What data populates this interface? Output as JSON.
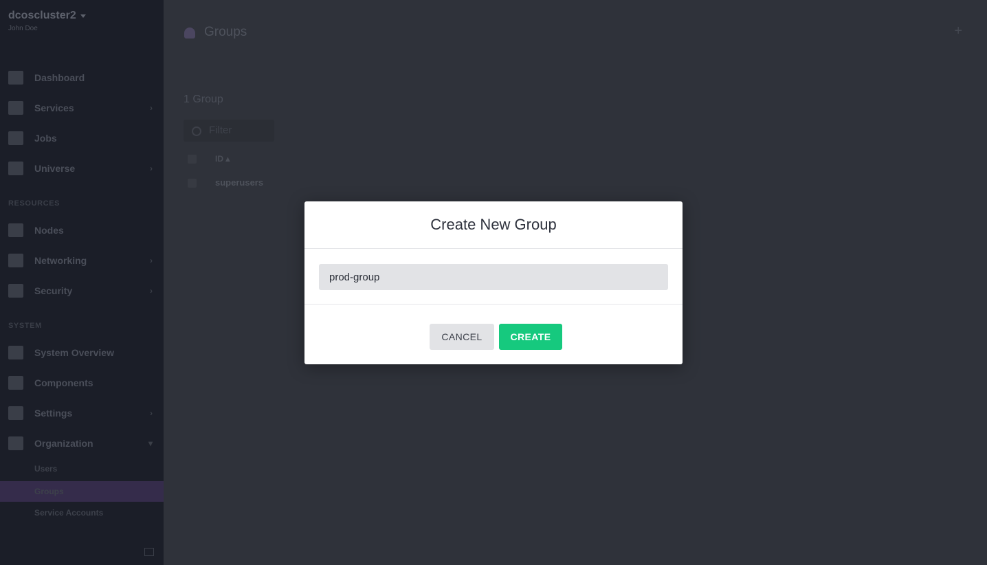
{
  "sidebar": {
    "cluster_name": "dcoscluster2",
    "user_name": "John Doe",
    "items": [
      {
        "label": "Dashboard",
        "icon": "dashboard-icon"
      },
      {
        "label": "Services",
        "icon": "services-icon"
      },
      {
        "label": "Jobs",
        "icon": "jobs-icon"
      },
      {
        "label": "Universe",
        "icon": "universe-icon"
      },
      {
        "label": "Nodes",
        "icon": "nodes-icon"
      },
      {
        "label": "Networking",
        "icon": "networking-icon"
      },
      {
        "label": "Security",
        "icon": "security-icon"
      },
      {
        "label": "System Overview",
        "icon": "system-overview-icon"
      },
      {
        "label": "Components",
        "icon": "components-icon"
      },
      {
        "label": "Settings",
        "icon": "gear-icon"
      },
      {
        "label": "Organization",
        "icon": "organization-icon"
      }
    ],
    "section_resources": "RESOURCES",
    "section_system": "SYSTEM",
    "org_sub_items": [
      "Users",
      "Groups",
      "Service Accounts"
    ],
    "active_sub_item": "Groups"
  },
  "main": {
    "title": "Groups",
    "count_label": "1 Group",
    "filter_placeholder": "Filter",
    "column_id": "ID",
    "rows": [
      "superusers"
    ]
  },
  "modal": {
    "title": "Create New Group",
    "input_value": "prod-group",
    "cancel_label": "CANCEL",
    "create_label": "CREATE"
  },
  "colors": {
    "create_button": "#16c97e",
    "modal_background": "#ffffff",
    "sidebar_background": "#1b1e28",
    "active_item_background": "#352c4b"
  }
}
